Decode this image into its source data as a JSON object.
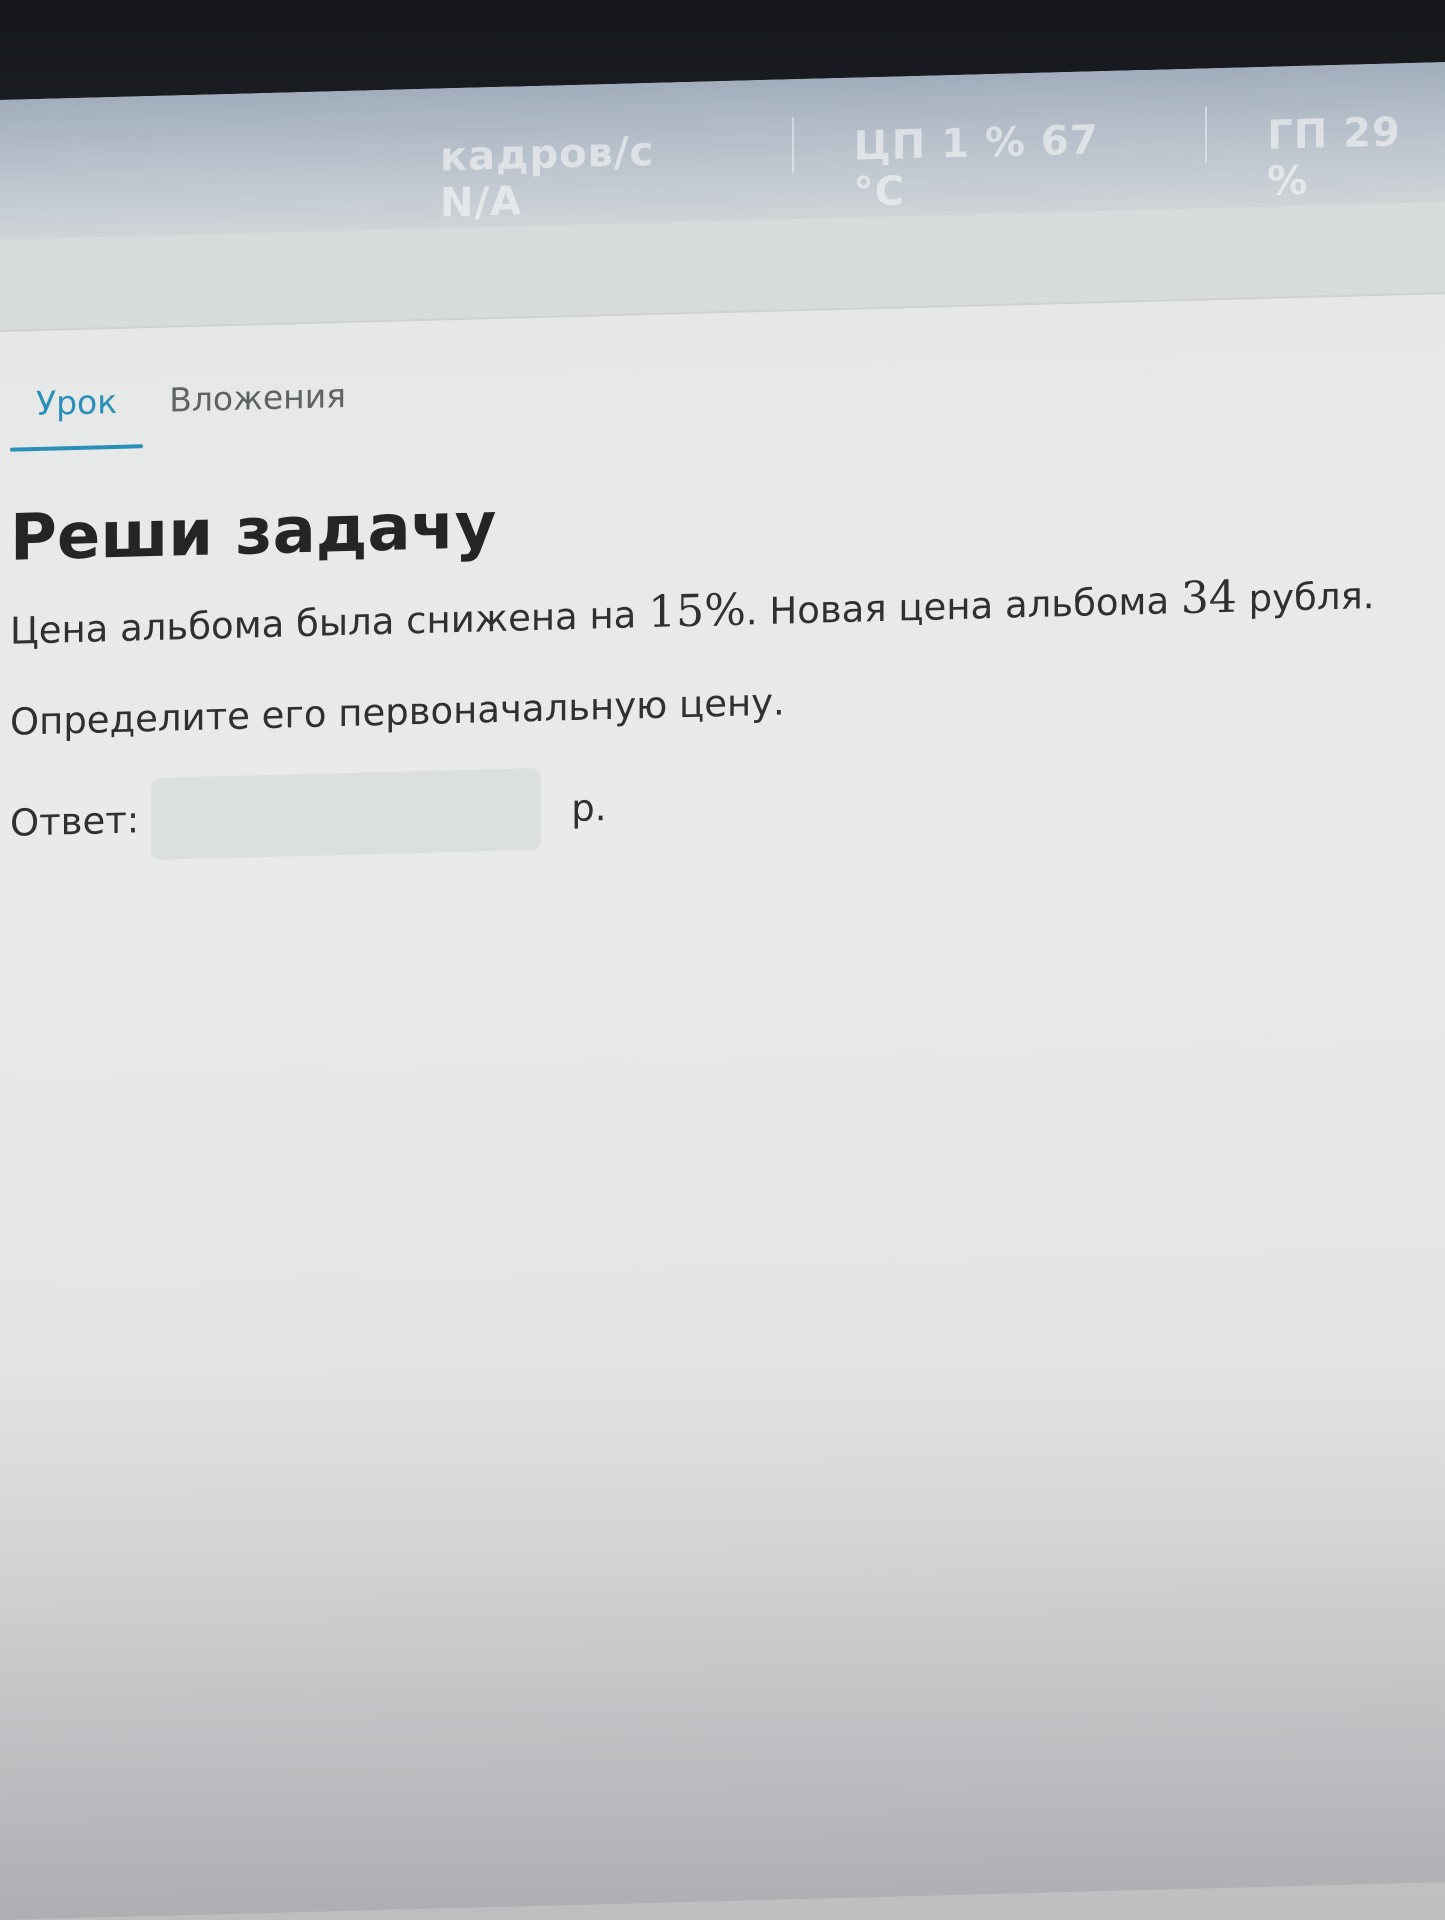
{
  "taskbar": {
    "net_label": "кадров/с  N/A",
    "cpu_label": "ЦП  1 %  67 °C",
    "gpu_label": "ГП  29 %"
  },
  "tabs": [
    {
      "label": "Урок",
      "active": true
    },
    {
      "label": "Вложения",
      "active": false
    }
  ],
  "task": {
    "title": "Реши задачу",
    "text_part1": "Цена альбома была снижена на ",
    "percent": "15%",
    "text_part2": ". Новая цена альбома ",
    "price": "34",
    "text_part3": " рубля.",
    "question": "Определите его первоначальную цену.",
    "answer_label": "Ответ:",
    "answer_value": "",
    "answer_unit": "р."
  },
  "colors": {
    "accent": "#2a8fb8"
  }
}
